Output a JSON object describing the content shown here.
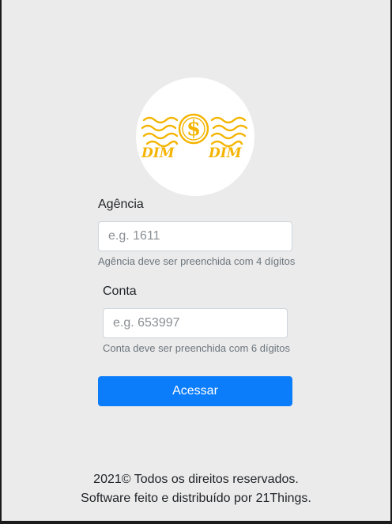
{
  "logo": {
    "left_text": "DIM",
    "right_text": "DIM",
    "symbol": "$",
    "color": "#f4b400"
  },
  "form": {
    "agencia": {
      "label": "Agência",
      "placeholder": "e.g. 1611",
      "help": "Agência deve ser preenchida com 4 dígitos"
    },
    "conta": {
      "label": "Conta",
      "placeholder": "e.g. 653997",
      "help": "Conta deve ser preenchida com 6 dígitos"
    },
    "submit_label": "Acessar"
  },
  "footer": {
    "line1": "2021© Todos os direitos reservados.",
    "line2": "Software feito e distribuído por 21Things."
  },
  "colors": {
    "primary": "#0b7dfb",
    "background": "#ebebeb",
    "logo": "#f4b400"
  }
}
